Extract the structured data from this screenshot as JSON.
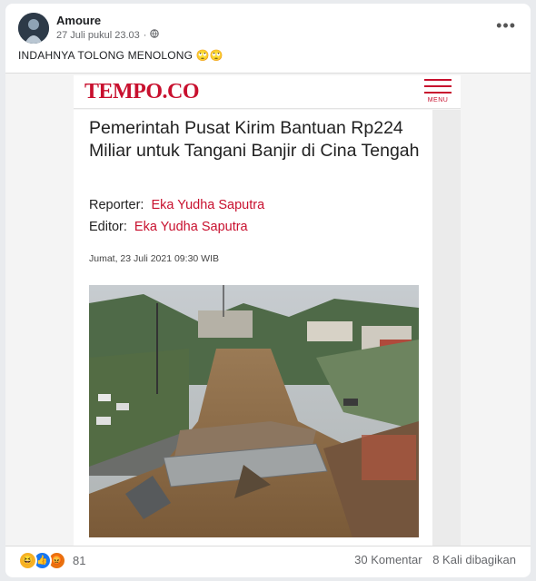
{
  "post": {
    "author": "Amoure",
    "timestamp": "27 Juli pukul 23.03",
    "privacy_icon": "globe-icon",
    "caption": "INDAHNYA TOLONG MENOLONG 🙄🙄"
  },
  "article": {
    "logo": "TEMPO.CO",
    "menu_label": "MENU",
    "headline": "Pemerintah Pusat Kirim Bantuan Rp224 Miliar untuk Tangani Banjir di Cina Tengah",
    "reporter_label": "Reporter:",
    "reporter_name": "Eka Yudha Saputra",
    "editor_label": "Editor:",
    "editor_name": "Eka Yudha Saputra",
    "date": "Jumat, 23 Juli 2021 09:30 WIB",
    "brand_color": "#c8102e"
  },
  "footer": {
    "reaction_count": "81",
    "comments": "30 Komentar",
    "shares": "8 Kali dibagikan"
  }
}
